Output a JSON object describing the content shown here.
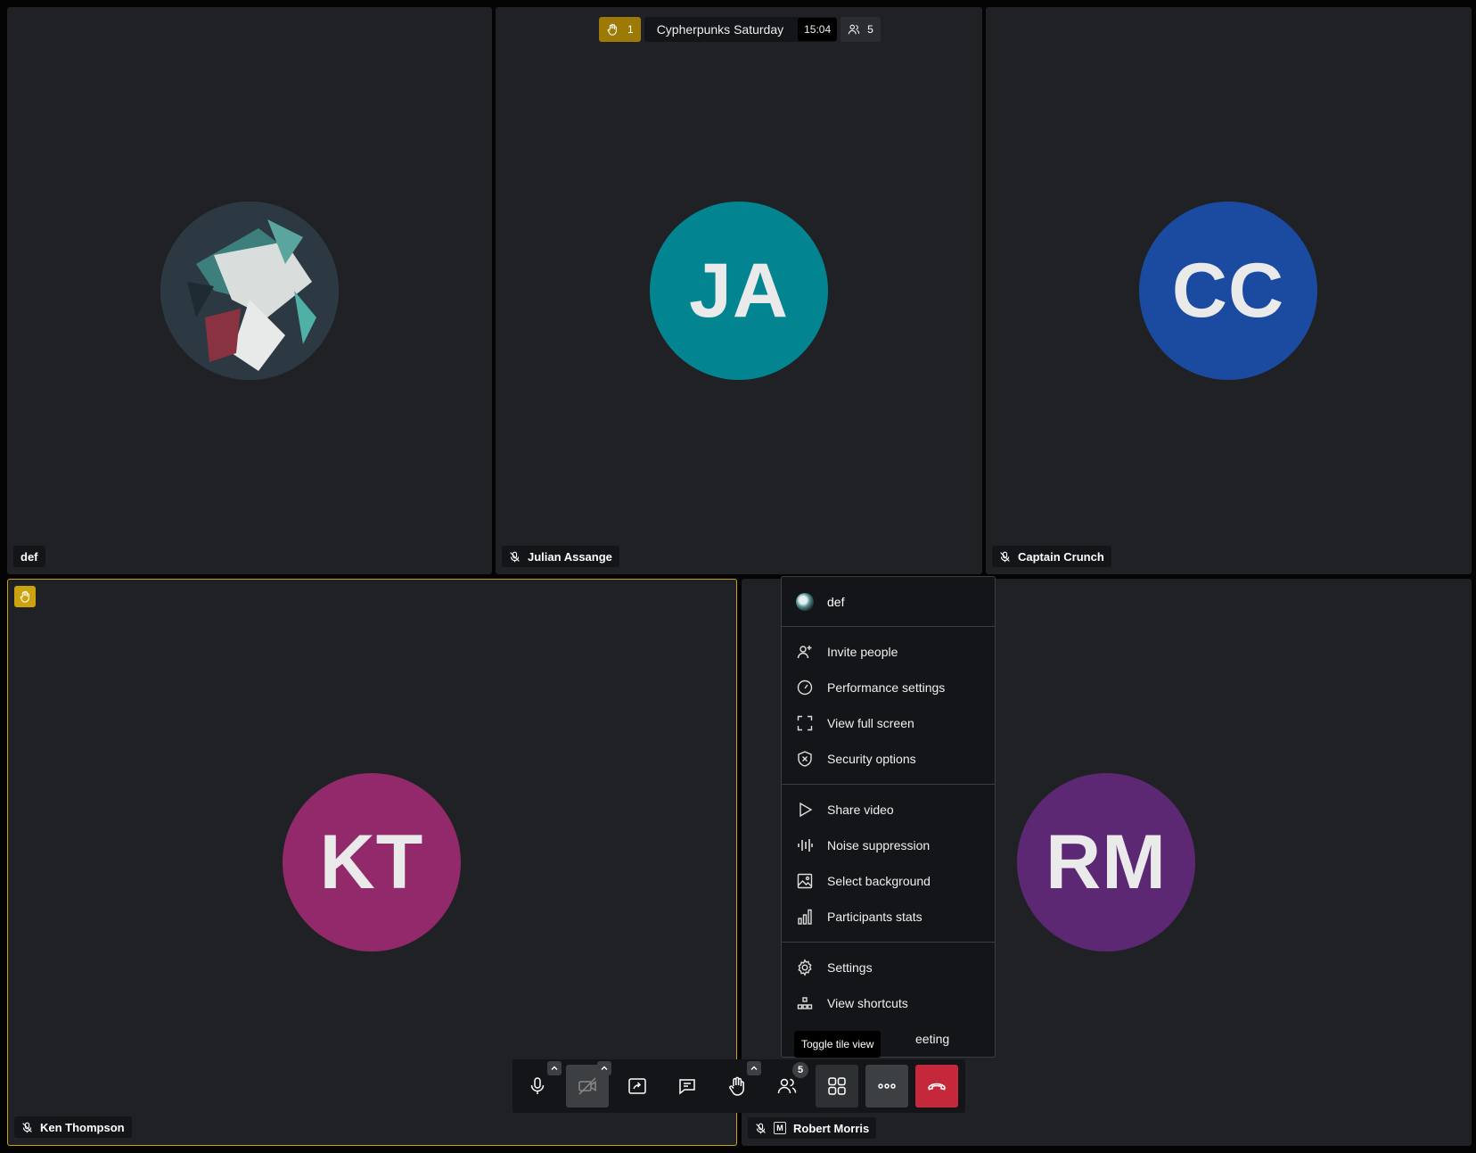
{
  "meeting": {
    "subject": "Cypherpunks Saturday",
    "timer": "15:04",
    "raised_hands_count": "1",
    "participant_count": "5"
  },
  "colors": {
    "accent_raised_hand": "#cca20e",
    "avatar_ja": "#028590",
    "avatar_cc": "#1a4ba0",
    "avatar_kt": "#92296b",
    "avatar_rm": "#5c2874",
    "hangup": "#c5283b"
  },
  "tiles": [
    {
      "name": "def",
      "initials": "",
      "has_image_avatar": true,
      "muted": false
    },
    {
      "name": "Julian Assange",
      "initials": "JA",
      "muted": true
    },
    {
      "name": "Captain Crunch",
      "initials": "CC",
      "muted": true
    },
    {
      "name": "Ken Thompson",
      "initials": "KT",
      "muted": true,
      "hand_raised": true
    },
    {
      "name": "Robert Morris",
      "initials": "RM",
      "muted": true,
      "moderator_badge": "M"
    }
  ],
  "menu": {
    "user_name": "def",
    "groups": [
      [
        {
          "label": "Invite people",
          "icon": "invite-icon"
        },
        {
          "label": "Performance settings",
          "icon": "gauge-icon"
        },
        {
          "label": "View full screen",
          "icon": "fullscreen-icon"
        },
        {
          "label": "Security options",
          "icon": "shield-icon"
        }
      ],
      [
        {
          "label": "Share video",
          "icon": "play-icon"
        },
        {
          "label": "Noise suppression",
          "icon": "waveform-icon"
        },
        {
          "label": "Select background",
          "icon": "image-icon"
        },
        {
          "label": "Participants stats",
          "icon": "bar-chart-icon"
        }
      ],
      [
        {
          "label": "Settings",
          "icon": "gear-icon"
        },
        {
          "label": "View shortcuts",
          "icon": "shortcuts-icon"
        },
        {
          "label": "eeting",
          "icon": ""
        }
      ]
    ]
  },
  "tooltip": "Toggle tile view",
  "toolbar": {
    "participants_badge": "5",
    "buttons": [
      "microphone",
      "camera-off",
      "share-screen",
      "chat",
      "raise-hand",
      "participants",
      "tile-view",
      "more",
      "hang-up"
    ]
  }
}
